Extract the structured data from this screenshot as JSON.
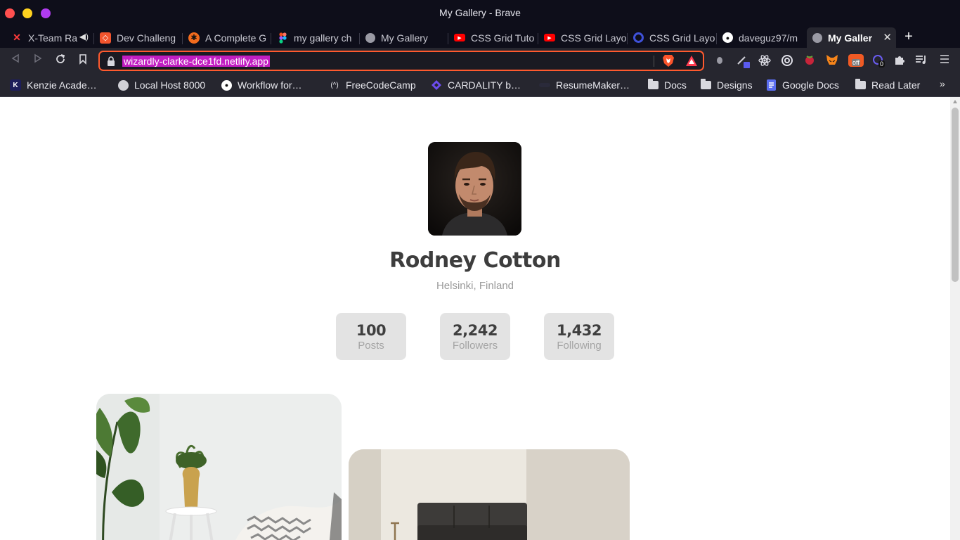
{
  "window": {
    "title": "My Gallery - Brave"
  },
  "tabs": [
    {
      "label": "X-Team Ra",
      "icon": "x-team-icon"
    },
    {
      "label": "Dev Challeng",
      "icon": "devchallenges-icon"
    },
    {
      "label": "A Complete G",
      "icon": "css-tricks-icon"
    },
    {
      "label": "my gallery ch",
      "icon": "figma-icon"
    },
    {
      "label": "My Gallery",
      "icon": "globe-icon"
    },
    {
      "label": "CSS Grid Tuto",
      "icon": "youtube-icon"
    },
    {
      "label": "CSS Grid Layo",
      "icon": "youtube-icon"
    },
    {
      "label": "CSS Grid Layo",
      "icon": "scrimba-icon"
    },
    {
      "label": "daveguz97/m",
      "icon": "github-icon"
    },
    {
      "label": "My Galler",
      "icon": "globe-icon",
      "active": true
    }
  ],
  "toolbar": {
    "url": "wizardly-clarke-dce1fd.netlify.app"
  },
  "bookmarks": [
    {
      "label": "Kenzie Acade…",
      "icon": "kenzie-icon"
    },
    {
      "label": "Local Host 8000",
      "icon": "globe-icon"
    },
    {
      "label": "Workflow for…",
      "icon": "github-icon"
    },
    {
      "label": "FreeCodeCamp",
      "icon": "freecodecamp-icon"
    },
    {
      "label": "CARDALITY b…",
      "icon": "cardality-icon"
    },
    {
      "label": "ResumeMaker…",
      "icon": "resumemaker-icon"
    },
    {
      "label": "Docs",
      "icon": "folder-icon"
    },
    {
      "label": "Designs",
      "icon": "folder-icon"
    },
    {
      "label": "Google Docs",
      "icon": "google-docs-icon"
    },
    {
      "label": "Read Later",
      "icon": "folder-icon"
    }
  ],
  "extensions": {
    "badge_off": "off",
    "badge_count": "0"
  },
  "profile": {
    "name": "Rodney Cotton",
    "location": "Helsinki, Finland",
    "stats": [
      {
        "value": "100",
        "label": "Posts"
      },
      {
        "value": "2,242",
        "label": "Followers"
      },
      {
        "value": "1,432",
        "label": "Following"
      }
    ]
  }
}
